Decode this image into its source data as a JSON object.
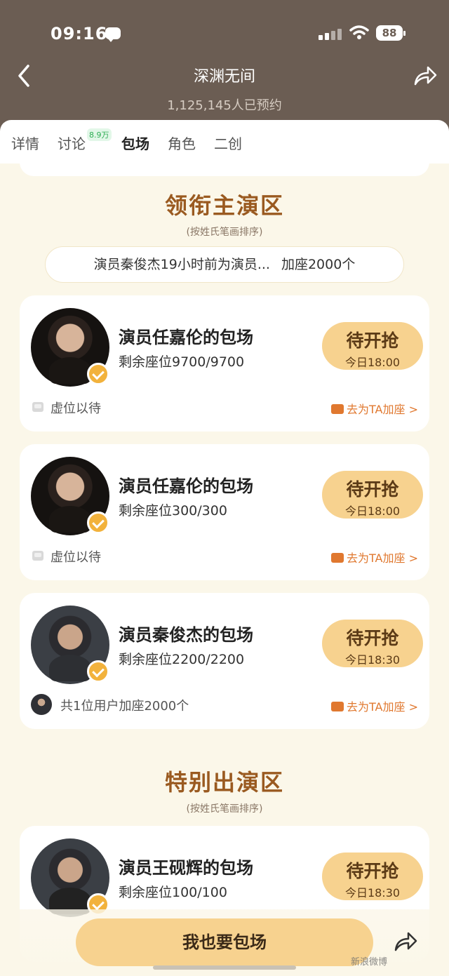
{
  "status_bar": {
    "time": "09:16",
    "battery": "88"
  },
  "header": {
    "title": "深渊无间",
    "subtitle": "1,125,145人已预约"
  },
  "tabs": [
    {
      "label": "详情"
    },
    {
      "label": "讨论",
      "badge": "8.9万"
    },
    {
      "label": "包场"
    },
    {
      "label": "角色"
    },
    {
      "label": "二创"
    }
  ],
  "section_lead": {
    "title": "领衔主演区",
    "note": "(按姓氏笔画排序)"
  },
  "ticker": {
    "left": "演员秦俊杰19小时前为演员...",
    "right": "加座2000个"
  },
  "cards": [
    {
      "title": "演员任嘉伦的包场",
      "seats": "剩余座位9700/9700",
      "button": "待开抢",
      "time": "今日18:00",
      "footer": "虚位以待",
      "action": "去为TA加座 >"
    },
    {
      "title": "演员任嘉伦的包场",
      "seats": "剩余座位300/300",
      "button": "待开抢",
      "time": "今日18:00",
      "footer": "虚位以待",
      "action": "去为TA加座 >"
    },
    {
      "title": "演员秦俊杰的包场",
      "seats": "剩余座位2200/2200",
      "button": "待开抢",
      "time": "今日18:30",
      "footer": "共1位用户加座2000个",
      "action": "去为TA加座 >"
    },
    {
      "title": "演员王砚辉的包场",
      "seats": "剩余座位100/100",
      "button": "待开抢",
      "time": "今日18:30"
    }
  ],
  "section_special": {
    "title": "特别出演区",
    "note": "(按姓氏笔画排序)"
  },
  "bottom": {
    "button": "我也要包场"
  },
  "watermark": "新浪微博"
}
